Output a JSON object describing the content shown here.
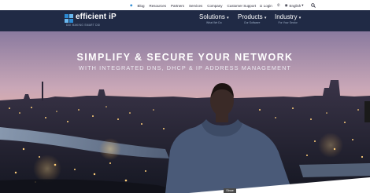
{
  "topnav": {
    "blog": "Blog",
    "resources": "Resources",
    "partners": "Partners",
    "services": "Services",
    "company": "Company",
    "support": "Customer Support",
    "login": "Login",
    "language": "English"
  },
  "brand": {
    "name": "efficient iP",
    "tagline": "DDI MAKING SMART DDI"
  },
  "menu": [
    {
      "label": "Solutions",
      "sub": "What We Do"
    },
    {
      "label": "Products",
      "sub": "Our Software"
    },
    {
      "label": "Industry",
      "sub": "For Your Sector"
    }
  ],
  "hero": {
    "headline": "SIMPLIFY & SECURE YOUR NETWORK",
    "subheadline": "WITH INTEGRATED DNS, DHCP & IP ADDRESS MANAGEMENT"
  },
  "footer_badge": "Since",
  "colors": {
    "nav_bg": "#202a45",
    "accent": "#2c8ad3"
  }
}
